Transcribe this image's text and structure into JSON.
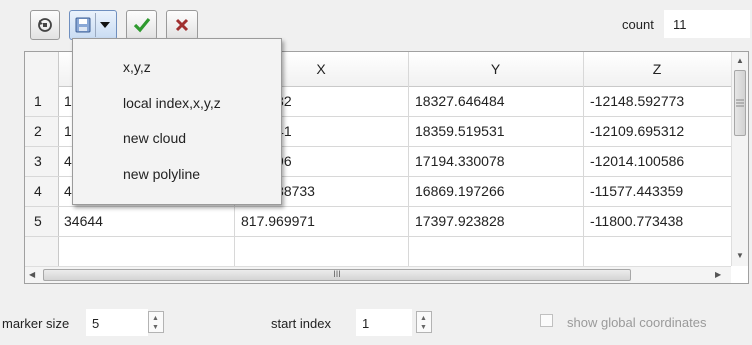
{
  "toolbar": {
    "buttons": [
      {
        "icon": "refresh-icon"
      },
      {
        "icon": "save-icon",
        "dropdown_icon": "chevron-down-icon"
      },
      {
        "icon": "checkmark-icon",
        "color": "#2e9a2e"
      },
      {
        "icon": "close-icon",
        "color": "#a03030"
      }
    ],
    "count_label": "count",
    "count_value": "11"
  },
  "menu": {
    "items": [
      "x,y,z",
      "local index,x,y,z",
      "new cloud",
      "new polyline"
    ]
  },
  "table": {
    "columns": [
      "",
      "X",
      "Y",
      "Z"
    ],
    "rows": [
      {
        "num": "1",
        "index": "1",
        "x": ".215332",
        "y": "18327.646484",
        "z": "-12148.592773"
      },
      {
        "num": "2",
        "index": "1",
        "x": ".734741",
        "y": "18359.519531",
        "z": "-12109.695312"
      },
      {
        "num": "3",
        "index": "4",
        "x": ".860596",
        "y": "17194.330078",
        "z": "-12014.100586"
      },
      {
        "num": "4",
        "index": "41089",
        "x": "734.388733",
        "y": "16869.197266",
        "z": "-11577.443359"
      },
      {
        "num": "5",
        "index": "34644",
        "x": "817.969971",
        "y": "17397.923828",
        "z": "-11800.773438"
      }
    ],
    "hscroll_grip": "III"
  },
  "bottom": {
    "marker_size_label": "marker size",
    "marker_size_value": "5",
    "start_index_label": "start index",
    "start_index_value": "1",
    "show_global_label": "show global coordinates",
    "show_global_checked": false
  }
}
